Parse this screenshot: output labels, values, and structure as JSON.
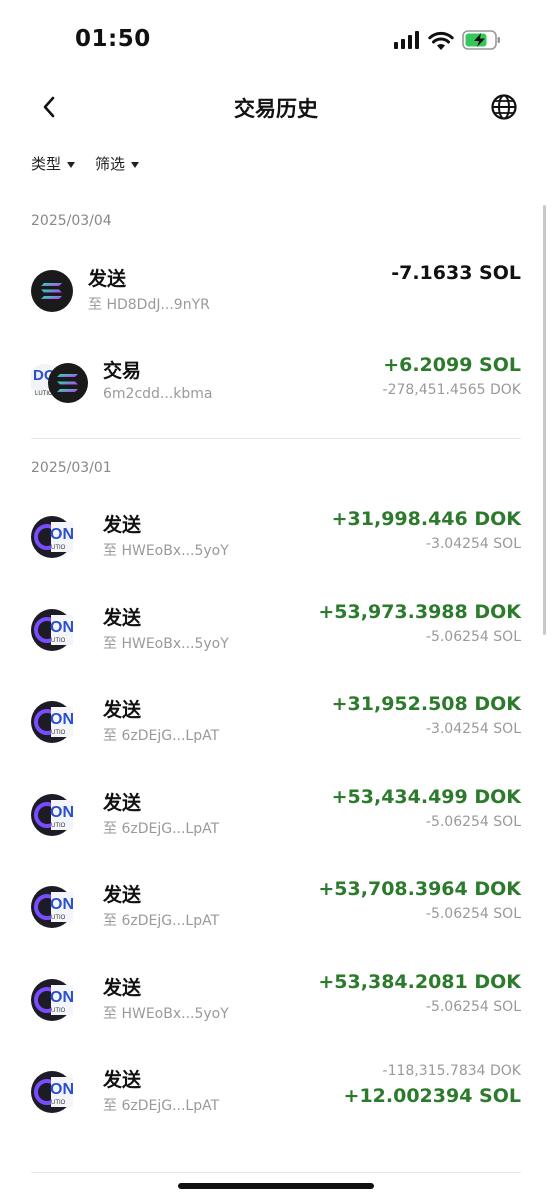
{
  "status": {
    "time": "01:50"
  },
  "nav": {
    "title": "交易历史"
  },
  "filters": {
    "type_label": "类型",
    "filter_label": "筛选"
  },
  "groups": [
    {
      "date": "2025/03/04",
      "items": [
        {
          "label": "发送",
          "address": "至 HD8DdJ...9nYR",
          "amount": "-7.1633 SOL",
          "sub": ""
        },
        {
          "label": "交易",
          "address": "6m2cdd...kbma",
          "amount": "+6.2099 SOL",
          "sub": "-278,451.4565 DOK"
        }
      ]
    },
    {
      "date": "2025/03/01",
      "items": [
        {
          "label": "发送",
          "address": "至 HWEoBx...5yoY",
          "amount": "+31,998.446 DOK",
          "sub": "-3.04254 SOL"
        },
        {
          "label": "发送",
          "address": "至 HWEoBx...5yoY",
          "amount": "+53,973.3988 DOK",
          "sub": "-5.06254 SOL"
        },
        {
          "label": "发送",
          "address": "至 6zDEjG...LpAT",
          "amount": "+31,952.508 DOK",
          "sub": "-3.04254 SOL"
        },
        {
          "label": "发送",
          "address": "至 6zDEjG...LpAT",
          "amount": "+53,434.499 DOK",
          "sub": "-5.06254 SOL"
        },
        {
          "label": "发送",
          "address": "至 6zDEjG...LpAT",
          "amount": "+53,708.3964 DOK",
          "sub": "-5.06254 SOL"
        },
        {
          "label": "发送",
          "address": "至 HWEoBx...5yoY",
          "amount": "+53,384.2081 DOK",
          "sub": "-5.06254 SOL"
        },
        {
          "label": "发送",
          "address": "至 6zDEjG...LpAT",
          "amount": "+12.002394 SOL",
          "sub": "-118,315.7834 DOK"
        }
      ]
    }
  ],
  "colors": {
    "positive": "#2c7a2c",
    "negative": "#111111",
    "muted": "#9a9a9a"
  }
}
